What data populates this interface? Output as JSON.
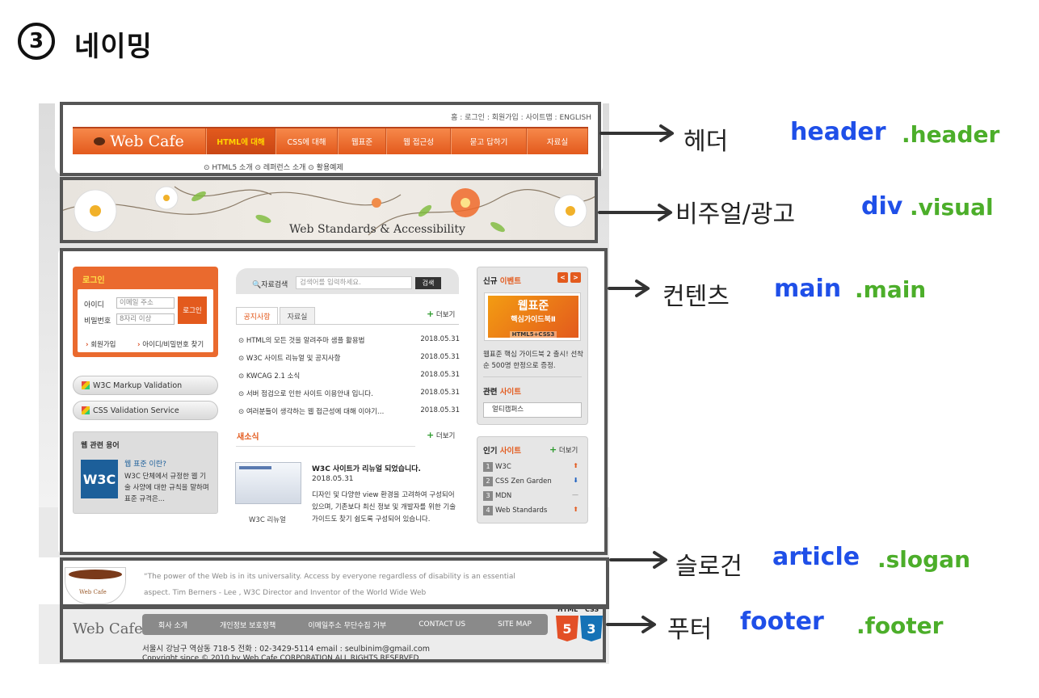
{
  "heading": {
    "number": "3",
    "text": "네이밍"
  },
  "header": {
    "util_links": "홈 : 로그인 : 회원가입 : 사이트맵 : ENGLISH",
    "logo": "Web Cafe",
    "menu": [
      "HTML에 대해",
      "CSS에 대해",
      "웹표준",
      "웹 접근성",
      "묻고 답하기",
      "자료실"
    ],
    "active_menu": 0,
    "sub_menu": "⊙ HTML5 소개   ⊙ 레퍼런스 소개   ⊙ 활용예제"
  },
  "visual": {
    "title": "Web Standards & Accessibility"
  },
  "login": {
    "title": "로그인",
    "id_label": "아이디",
    "id_placeholder": "이메일 주소",
    "pw_label": "비밀번호",
    "pw_placeholder": "8자리 이상",
    "button": "로그인",
    "join_link": "회원가입",
    "find_link": "아이디/비밀번호 찾기"
  },
  "validators": [
    "W3C Markup Validation",
    "CSS Validation Service"
  ],
  "glossary": {
    "title": "웹 관련 용어",
    "logo": "W3C",
    "term": "웹 표준 이란?",
    "desc": "W3C 단체에서 규정한 웹 기술 사양에 대한 규칙을 말하며 표준 규격은..."
  },
  "search": {
    "label": "자료검색",
    "placeholder": "검색어를 입력하세요.",
    "button": "검색"
  },
  "tabs": [
    "공지사항",
    "자료실"
  ],
  "more": "더보기",
  "notices": [
    {
      "title": "⊙ HTML의 모든 것을 알려주마 샘플 활용법",
      "date": "2018.05.31"
    },
    {
      "title": "⊙ W3C 사이트 리뉴얼 및 공지사항",
      "date": "2018.05.31"
    },
    {
      "title": "⊙ KWCAG 2.1 소식",
      "date": "2018.05.31"
    },
    {
      "title": "⊙ 서버 점검으로 인한 사이트 이용안내 입니다.",
      "date": "2018.05.31"
    },
    {
      "title": "⊙ 여러분들이 생각하는 웹 접근성에 대해 이야기…",
      "date": "2018.05.31"
    }
  ],
  "news": {
    "heading": "새소식",
    "title": "W3C 사이트가 리뉴얼 되었습니다.",
    "date": "2018.05.31",
    "body": "디자인 및 다양한 view 환경을 고려하여 구성되어 있으며, 기존보다 최신 정보 및 개발자를 위한 기술 가이드도 찾기 쉽도록 구성되어 있습니다.",
    "caption": "W3C 리뉴얼"
  },
  "event": {
    "head_a": "신규 ",
    "head_b": "이벤트",
    "prev": "<",
    "next": ">",
    "book_l1": "웹표준",
    "book_l2": "핵심가이드북Ⅱ",
    "book_l3": "HTML5+CSS3",
    "text": "웹표준 핵심 가이드북 2 출시! 선착순 500명 한정으로 증정."
  },
  "related": {
    "head_a": "관련 ",
    "head_b": "사이트",
    "select": "얼티캠퍼스"
  },
  "popular": {
    "head_a": "인기 ",
    "head_b": "사이트",
    "items": [
      {
        "n": "1",
        "name": "W3C",
        "trend": "⬆"
      },
      {
        "n": "2",
        "name": "CSS Zen Garden",
        "trend": "⬇"
      },
      {
        "n": "3",
        "name": "MDN",
        "trend": "—"
      },
      {
        "n": "4",
        "name": "Web Standards",
        "trend": "⬆"
      }
    ]
  },
  "slogan": {
    "cup_label": "Web Cafe",
    "quote": "“The power of the Web is in its universality. Access by everyone regardless of disability is an essential aspect. Tim Berners - Lee , W3C Director and Inventor of the World Wide Web"
  },
  "footer": {
    "logo": "Web Cafe",
    "nav": [
      "회사 소개",
      "개인정보 보호정책",
      "이메일주소 무단수집 거부",
      "CONTACT US",
      "SITE MAP"
    ],
    "html5_badge": "5",
    "css3_badge": "3",
    "html_cap": "HTML",
    "css_cap": "CSS",
    "address": "서울시 강남구 역삼동 718-5 전화 : 02-3429-5114 email : seulbinim@gmail.com",
    "copyright": "Copyright since © 2010 by Web Cafe CORPORATION ALL RIGHTS RESERVED"
  },
  "annotations": [
    {
      "ko": "헤더",
      "tag": "header",
      "cls": ".header"
    },
    {
      "ko": "비주얼/광고",
      "tag": "div",
      "cls": ".visual"
    },
    {
      "ko": "컨텐츠",
      "tag": "main",
      "cls": ".main"
    },
    {
      "ko": "슬로건",
      "tag": "article",
      "cls": ".slogan"
    },
    {
      "ko": "푸터",
      "tag": "footer",
      "cls": ".footer"
    }
  ]
}
